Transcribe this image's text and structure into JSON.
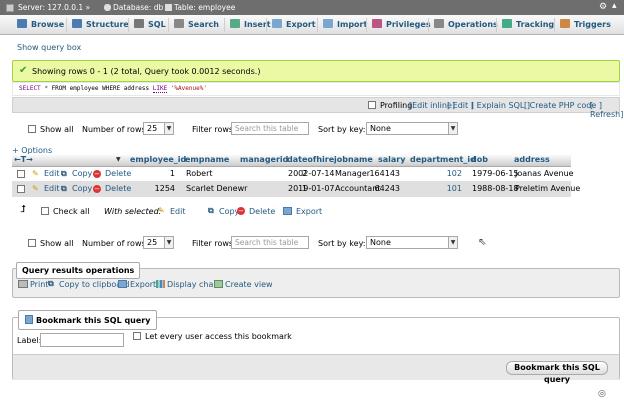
{
  "breadcrumb": {
    "server": "Server: 127.0.0.1 »",
    "database": "Database: db »",
    "table": "Table: employee"
  },
  "tabs": [
    "Browse",
    "Structure",
    "SQL",
    "Search",
    "Insert",
    "Export",
    "Import",
    "Privileges",
    "Operations",
    "Tracking",
    "Triggers"
  ],
  "show_query_box": "Show query box",
  "success_message": "Showing rows 0 - 1 (2 total, Query took 0.0012 seconds.)",
  "sql": {
    "select": "SELECT",
    "star": "*",
    "from_table": "FROM employee WHERE address",
    "like": "LIKE",
    "pattern": "'%Avenue%'"
  },
  "profiling": {
    "label": "Profiling",
    "edit_inline": "[Edit inline]",
    "edit": "[ Edit ]",
    "explain": "[ Explain SQL ]",
    "php": "[ Create PHP code ]",
    "refresh": "[ Refresh]"
  },
  "nav": {
    "show_all": "Show all",
    "rows_label": "Number of rows:",
    "rows_value": "25",
    "filter_label": "Filter rows:",
    "filter_placeholder": "Search this table",
    "sort_label": "Sort by key:",
    "sort_value": "None"
  },
  "options_link": "+ Options",
  "table": {
    "columns": [
      "employee_id",
      "empname",
      "managerid",
      "dateofhire",
      "jobname",
      "salary",
      "department_id",
      "dob",
      "address"
    ],
    "action_edit": "Edit",
    "action_copy": "Copy",
    "action_delete": "Delete",
    "rows": [
      [
        "1",
        "Robert",
        "2",
        "2002-07-14",
        "Manager",
        "164143",
        "102",
        "1979-06-15",
        "Joanas Avenue"
      ],
      [
        "1254",
        "Scarlet Denewr",
        "1",
        "2019-01-07",
        "Accountant",
        "64243",
        "101",
        "1988-08-18",
        "Preletim Avenue"
      ]
    ]
  },
  "bulk": {
    "check_all": "Check all",
    "with_selected": "With selected:",
    "edit": "Edit",
    "copy": "Copy",
    "delete": "Delete",
    "export": "Export"
  },
  "query_ops": {
    "legend": "Query results operations",
    "print": "Print",
    "clipboard": "Copy to clipboard",
    "export": "Export",
    "chart": "Display chart",
    "view": "Create view"
  },
  "bookmark": {
    "legend": "Bookmark this SQL query",
    "label": "Label:",
    "every_user": "Let every user access this bookmark",
    "button": "Bookmark this SQL query"
  },
  "colors": {
    "link": "#235a81",
    "success_bg": "#ebf8a4",
    "titlebar": "#6e6e6e"
  }
}
